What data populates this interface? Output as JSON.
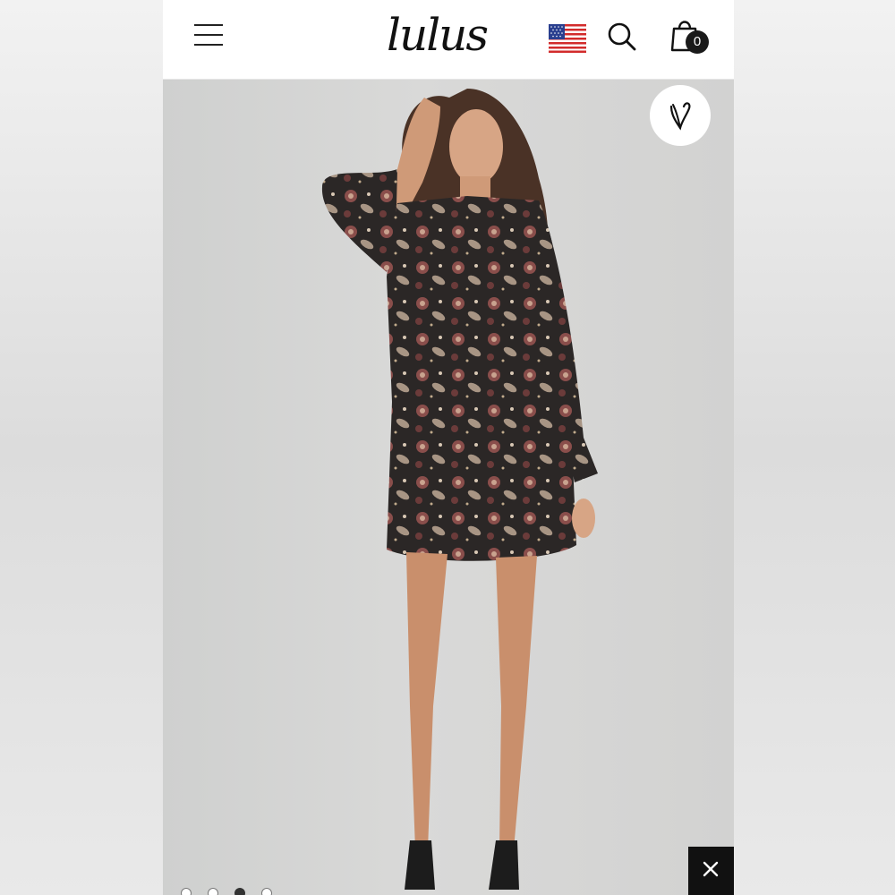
{
  "header": {
    "logo_text": "lulus",
    "cart_count": "0"
  },
  "icons": {
    "menu": "hamburger-menu-icon",
    "flag": "us-flag-icon",
    "search": "search-icon",
    "cart": "shopping-bag-icon",
    "wishlist": "heart-icon",
    "close": "close-icon"
  },
  "carousel": {
    "slide_count": 4,
    "active_index": 2
  },
  "colors": {
    "header_bg": "#ffffff",
    "badge_bg": "#1a1a1a",
    "close_bg": "#111111"
  }
}
